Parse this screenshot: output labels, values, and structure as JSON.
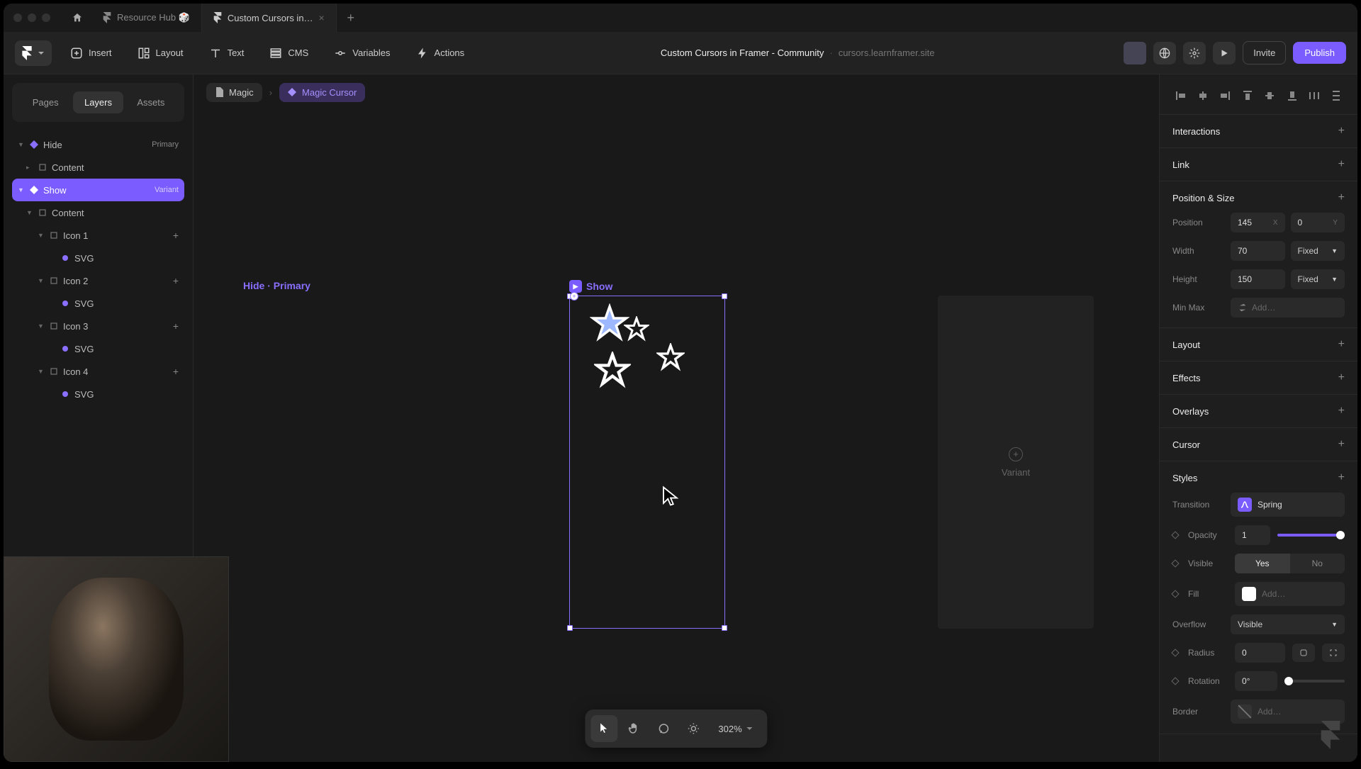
{
  "titlebar": {
    "tab1": "Resource Hub 🎲",
    "tab2": "Custom Cursors in…"
  },
  "toolbar": {
    "insert": "Insert",
    "layout": "Layout",
    "text": "Text",
    "cms": "CMS",
    "variables": "Variables",
    "actions": "Actions",
    "title": "Custom Cursors in Framer - Community",
    "url": "cursors.learnframer.site",
    "invite": "Invite",
    "publish": "Publish"
  },
  "leftPanel": {
    "tabs": {
      "pages": "Pages",
      "layers": "Layers",
      "assets": "Assets"
    },
    "layers": {
      "hide": "Hide",
      "primary": "Primary",
      "content": "Content",
      "show": "Show",
      "variant": "Variant",
      "icon1": "Icon 1",
      "icon2": "Icon 2",
      "icon3": "Icon 3",
      "icon4": "Icon 4",
      "svg": "SVG"
    }
  },
  "breadcrumb": {
    "magic": "Magic",
    "magicCursor": "Magic Cursor"
  },
  "canvas": {
    "hideLabel": "Hide · Primary",
    "showLabel": "Show",
    "variantGhost": "Variant"
  },
  "bottomBar": {
    "zoom": "302%"
  },
  "rightPanel": {
    "interactions": "Interactions",
    "link": "Link",
    "positionSize": "Position & Size",
    "position": "Position",
    "posX": "145",
    "posY": "0",
    "width": "Width",
    "widthVal": "70",
    "widthMode": "Fixed",
    "height": "Height",
    "heightVal": "150",
    "heightMode": "Fixed",
    "minMax": "Min Max",
    "addPlaceholder": "Add…",
    "layout": "Layout",
    "effects": "Effects",
    "overlays": "Overlays",
    "cursor": "Cursor",
    "styles": "Styles",
    "transition": "Transition",
    "transitionVal": "Spring",
    "opacity": "Opacity",
    "opacityVal": "1",
    "visible": "Visible",
    "yes": "Yes",
    "no": "No",
    "fill": "Fill",
    "overflow": "Overflow",
    "overflowVal": "Visible",
    "radius": "Radius",
    "radiusVal": "0",
    "rotation": "Rotation",
    "rotationVal": "0°",
    "border": "Border"
  }
}
